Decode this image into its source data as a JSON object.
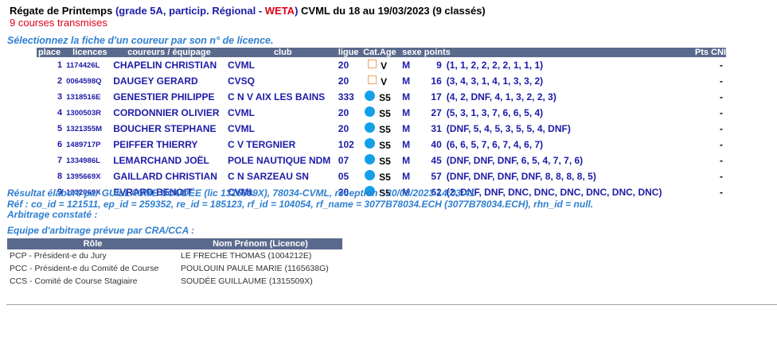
{
  "header": {
    "title": "Régate de Printemps",
    "grade": "(grade 5A, particip. Régional - ",
    "weta": "WETA",
    "close": ")",
    "club_dates": " CVML du 18 au 19/03/2023 (9 classés)",
    "courses": "9 courses transmises"
  },
  "select_prompt": "Sélectionnez la fiche d'un coureur par son n° de licence.",
  "results": {
    "columns": [
      "place",
      "licences",
      "coureurs / équipage",
      "club",
      "ligue",
      "Cat.Age",
      "sexe",
      "points",
      "Pts CNI"
    ],
    "rows": [
      {
        "place": "1",
        "licence": "1174426L",
        "name": "CHAPELIN CHRISTIAN",
        "club": "CVML",
        "ligue": "20",
        "cat": "V",
        "icon": "square",
        "sexe": "M",
        "points": "9",
        "detail": "(1, 1, 2, 2, 2, 2, 1, 1, 1)",
        "cni": "-"
      },
      {
        "place": "2",
        "licence": "0064598Q",
        "name": "DAUGEY GERARD",
        "club": "CVSQ",
        "ligue": "20",
        "cat": "V",
        "icon": "square",
        "sexe": "M",
        "points": "16",
        "detail": "(3, 4, 3, 1, 4, 1, 3, 3, 2)",
        "cni": "-"
      },
      {
        "place": "3",
        "licence": "1318516E",
        "name": "GENESTIER PHILIPPE",
        "club": "C N V AIX LES BAINS",
        "ligue": "333",
        "cat": "S5",
        "icon": "dot",
        "sexe": "M",
        "points": "17",
        "detail": "(4, 2, DNF, 4, 1, 3, 2, 2, 3)",
        "cni": "-"
      },
      {
        "place": "4",
        "licence": "1300503R",
        "name": "CORDONNIER OLIVIER",
        "club": "CVML",
        "ligue": "20",
        "cat": "S5",
        "icon": "dot",
        "sexe": "M",
        "points": "27",
        "detail": "(5, 3, 1, 3, 7, 6, 6, 5, 4)",
        "cni": "-"
      },
      {
        "place": "5",
        "licence": "1321355M",
        "name": "BOUCHER STEPHANE",
        "club": "CVML",
        "ligue": "20",
        "cat": "S5",
        "icon": "dot",
        "sexe": "M",
        "points": "31",
        "detail": "(DNF, 5, 4, 5, 3, 5, 5, 4, DNF)",
        "cni": "-"
      },
      {
        "place": "6",
        "licence": "1489717P",
        "name": "PEIFFER THIERRY",
        "club": "C V TERGNIER",
        "ligue": "102",
        "cat": "S5",
        "icon": "dot",
        "sexe": "M",
        "points": "40",
        "detail": "(6, 6, 5, 7, 6, 7, 4, 6, 7)",
        "cni": "-"
      },
      {
        "place": "7",
        "licence": "1334986L",
        "name": "LEMARCHAND JOËL",
        "club": "POLE NAUTIQUE NDM",
        "ligue": "07",
        "cat": "S5",
        "icon": "dot",
        "sexe": "M",
        "points": "45",
        "detail": "(DNF, DNF, DNF, 6, 5, 4, 7, 7, 6)",
        "cni": "-"
      },
      {
        "place": "8",
        "licence": "1395669X",
        "name": "GAILLARD CHRISTIAN",
        "club": "C N SARZEAU SN",
        "ligue": "05",
        "cat": "S5",
        "icon": "dot",
        "sexe": "M",
        "points": "57",
        "detail": "(DNF, DNF, DNF, DNF, 8, 8, 8, 8, 5)",
        "cni": "-"
      },
      {
        "place": "9",
        "licence": "1332069X",
        "name": "EVRARD BENOIT",
        "club": "CVML",
        "ligue": "20",
        "cat": "S5",
        "icon": "dot",
        "sexe": "M",
        "points": "62",
        "detail": "(2, DNF, DNF, DNC, DNC, DNC, DNC, DNC, DNC)",
        "cni": "-"
      }
    ]
  },
  "info": {
    "result_line": "Résultat élaboré par GUILLAUME SOUDÉE (lic 1315509X), 78034-CVML, réception : 20/03/2023 14:03:41",
    "ref_line": "Réf : co_id = 121511, ep_id = 259352, re_id = 185123, rf_id = 104054, rf_name = 3077B78034.ECH (3077B78034.ECH), rhn_id = null.",
    "arbitrage": "Arbitrage constaté :",
    "equipe": "Equipe d'arbitrage prévue par CRA/CCA :"
  },
  "arbitrage_table": {
    "headers": [
      "Rôle",
      "Nom Prénom (Licence)"
    ],
    "rows": [
      {
        "role": "PCP - Président-e du Jury",
        "name": "LE FRECHE THOMAS (1004212E)"
      },
      {
        "role": "PCC - Président-e du Comité de Course",
        "name": "POULOUIN PAULE MARIE (1165638G)"
      },
      {
        "role": "CCS - Comité de Course Stagiaire",
        "name": "SOUDÉE GUILLAUME (1315509X)"
      }
    ]
  },
  "colors": {
    "header_bg": "#5a6a8c",
    "link_blue": "#1c1ca8",
    "info_blue": "#2f7fd0",
    "red": "#e0001a",
    "dot": "#13a0e8",
    "square": "#f0a060"
  }
}
